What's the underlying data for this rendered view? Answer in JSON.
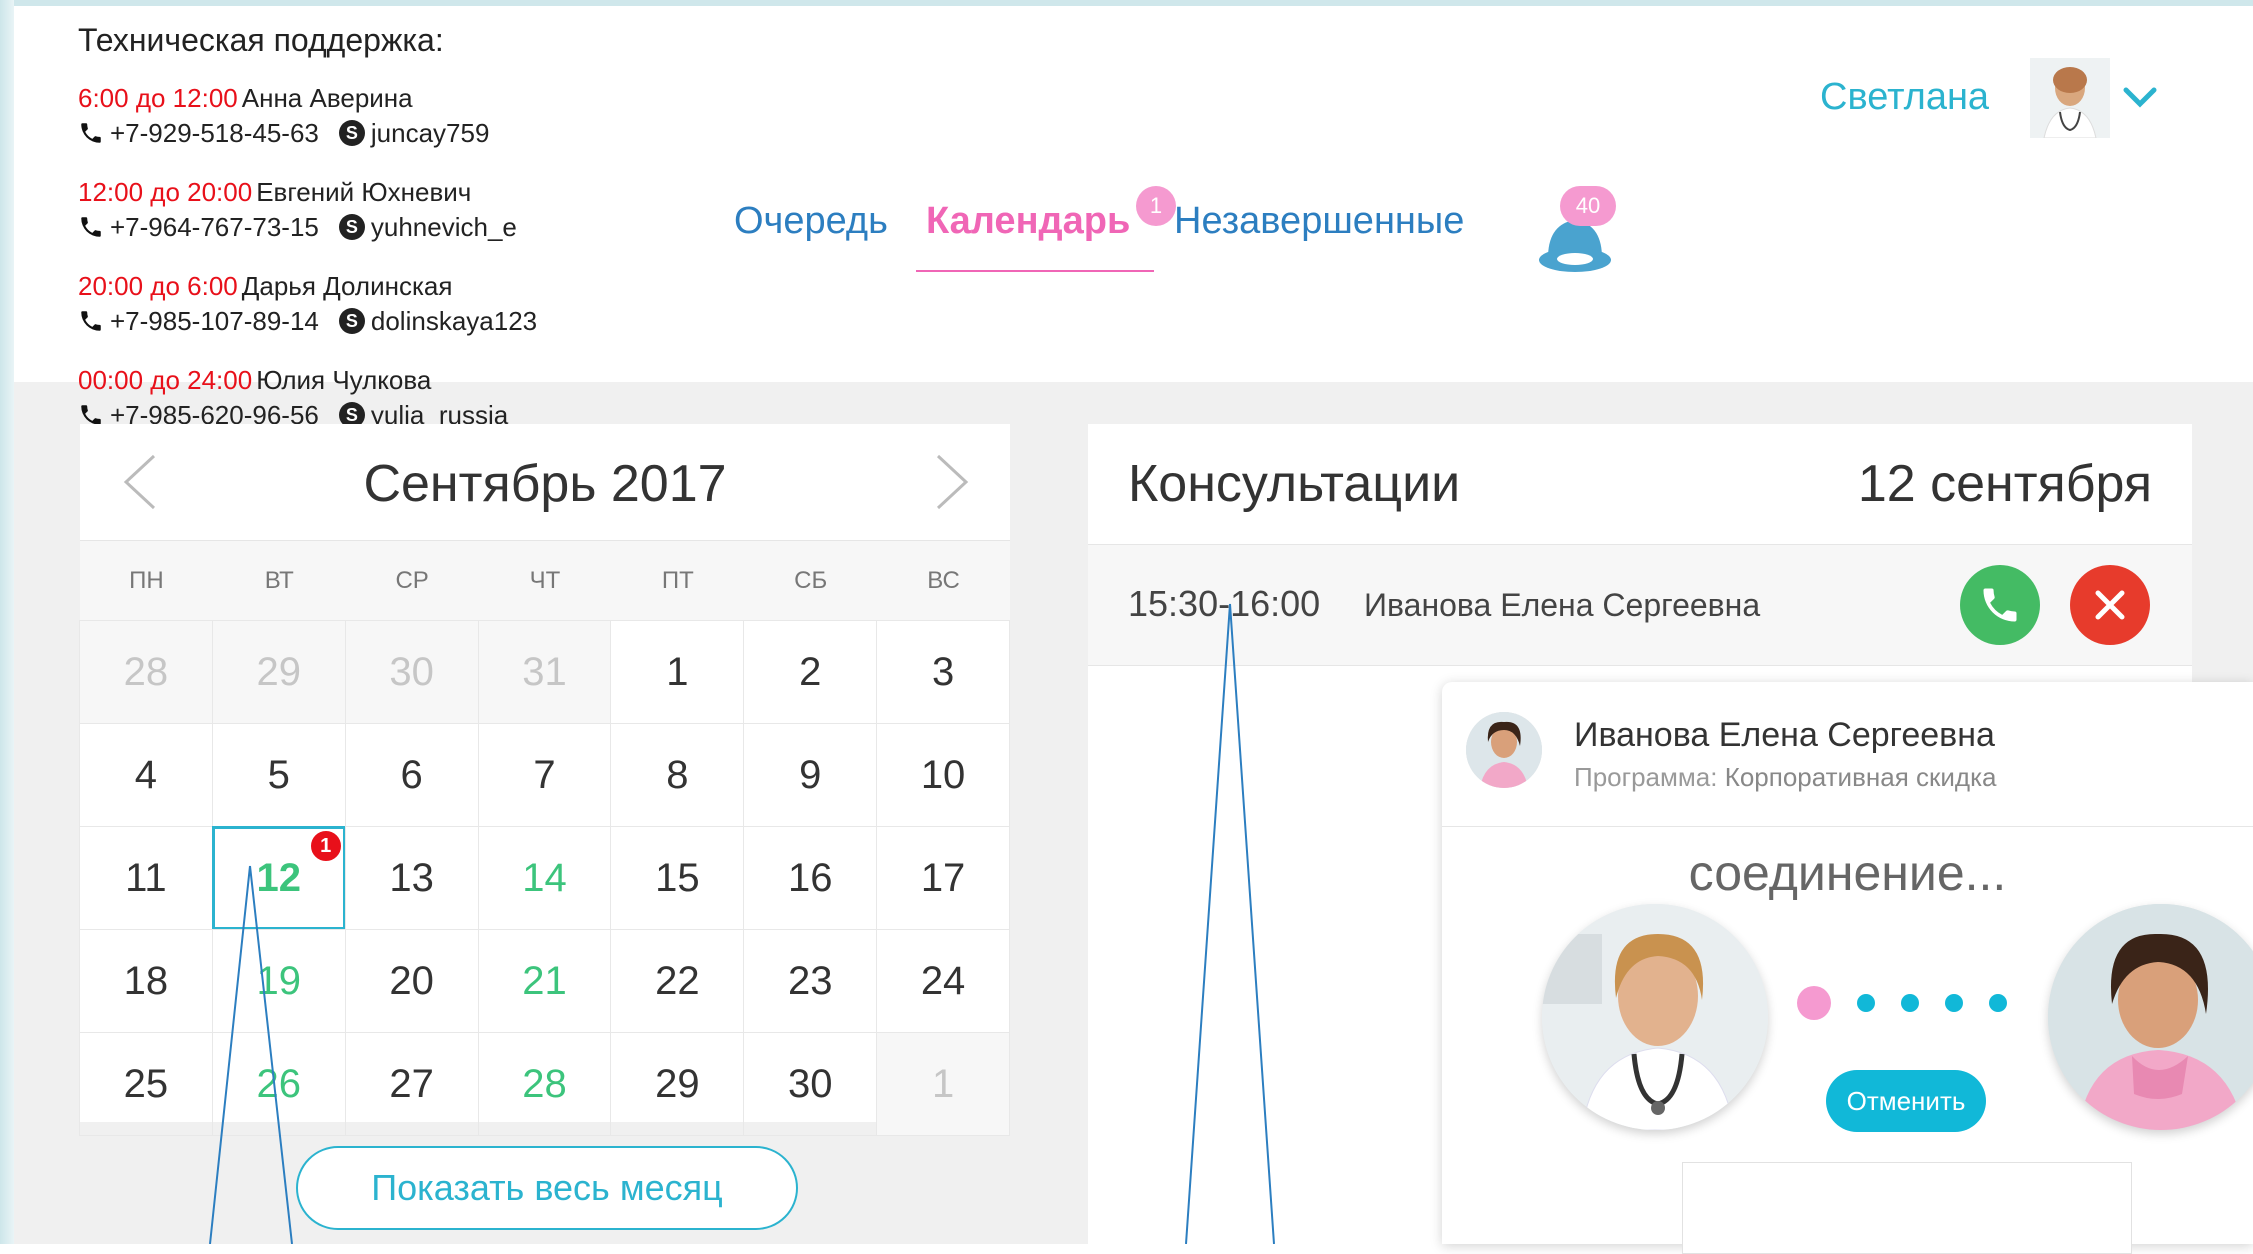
{
  "support": {
    "title": "Техническая поддержка:",
    "shifts": [
      {
        "time": "6:00 до 12:00",
        "name": "Анна Аверина",
        "phone": "+7-929-518-45-63",
        "skype": "juncay759"
      },
      {
        "time": "12:00 до 20:00",
        "name": "Евгений Юхневич",
        "phone": "+7-964-767-73-15",
        "skype": "yuhnevich_e"
      },
      {
        "time": "20:00 до 6:00",
        "name": "Дарья Долинская",
        "phone": "+7-985-107-89-14",
        "skype": "dolinskaya123"
      },
      {
        "time": "00:00 до 24:00",
        "name": "Юлия Чулкова",
        "phone": "+7-985-620-96-56",
        "skype": "yulia_russia"
      }
    ]
  },
  "user": {
    "name": "Светлана",
    "avatar_icon": "doctor-avatar",
    "menu_icon": "chevron-down-icon"
  },
  "nav": {
    "queue": "Очередь",
    "calendar": "Календарь",
    "calendar_badge": "1",
    "unfinished": "Незавершенные",
    "notifications_badge": "40",
    "notifications_icon": "bell-icon"
  },
  "calendar": {
    "title": "Сентябрь 2017",
    "weekdays": [
      "ПН",
      "ВТ",
      "СР",
      "ЧТ",
      "ПТ",
      "СБ",
      "ВС"
    ],
    "days": [
      {
        "d": "28",
        "s": "other"
      },
      {
        "d": "29",
        "s": "other"
      },
      {
        "d": "30",
        "s": "other"
      },
      {
        "d": "31",
        "s": "other"
      },
      {
        "d": "1",
        "s": ""
      },
      {
        "d": "2",
        "s": ""
      },
      {
        "d": "3",
        "s": ""
      },
      {
        "d": "4",
        "s": ""
      },
      {
        "d": "5",
        "s": ""
      },
      {
        "d": "6",
        "s": ""
      },
      {
        "d": "7",
        "s": ""
      },
      {
        "d": "8",
        "s": ""
      },
      {
        "d": "9",
        "s": ""
      },
      {
        "d": "10",
        "s": ""
      },
      {
        "d": "11",
        "s": ""
      },
      {
        "d": "12",
        "s": "selected",
        "badge": "1"
      },
      {
        "d": "13",
        "s": ""
      },
      {
        "d": "14",
        "s": "green"
      },
      {
        "d": "15",
        "s": ""
      },
      {
        "d": "16",
        "s": ""
      },
      {
        "d": "17",
        "s": ""
      },
      {
        "d": "18",
        "s": ""
      },
      {
        "d": "19",
        "s": "green"
      },
      {
        "d": "20",
        "s": ""
      },
      {
        "d": "21",
        "s": "green"
      },
      {
        "d": "22",
        "s": ""
      },
      {
        "d": "23",
        "s": ""
      },
      {
        "d": "24",
        "s": ""
      },
      {
        "d": "25",
        "s": ""
      },
      {
        "d": "26",
        "s": "green"
      },
      {
        "d": "27",
        "s": ""
      },
      {
        "d": "28",
        "s": "green"
      },
      {
        "d": "29",
        "s": ""
      },
      {
        "d": "30",
        "s": ""
      },
      {
        "d": "1",
        "s": "other"
      }
    ],
    "show_month": "Показать весь месяц"
  },
  "consultations": {
    "title": "Консультации",
    "date": "12 сентября",
    "rows": [
      {
        "time": "15:30-16:00",
        "patient": "Иванова Елена Сергеевна"
      }
    ]
  },
  "popup": {
    "name": "Иванова Елена Сергеевна",
    "program_label": "Программа:",
    "program": "Корпоративная скидка",
    "status": "соединение...",
    "cancel": "Отменить"
  },
  "colors": {
    "accent": "#2bb3cf",
    "pink": "#f066b6",
    "nav_blue": "#2c7ec0",
    "red": "#e8101a",
    "green": "#3cc47c",
    "call_green": "#44bb64",
    "decline_red": "#e73b2c"
  }
}
